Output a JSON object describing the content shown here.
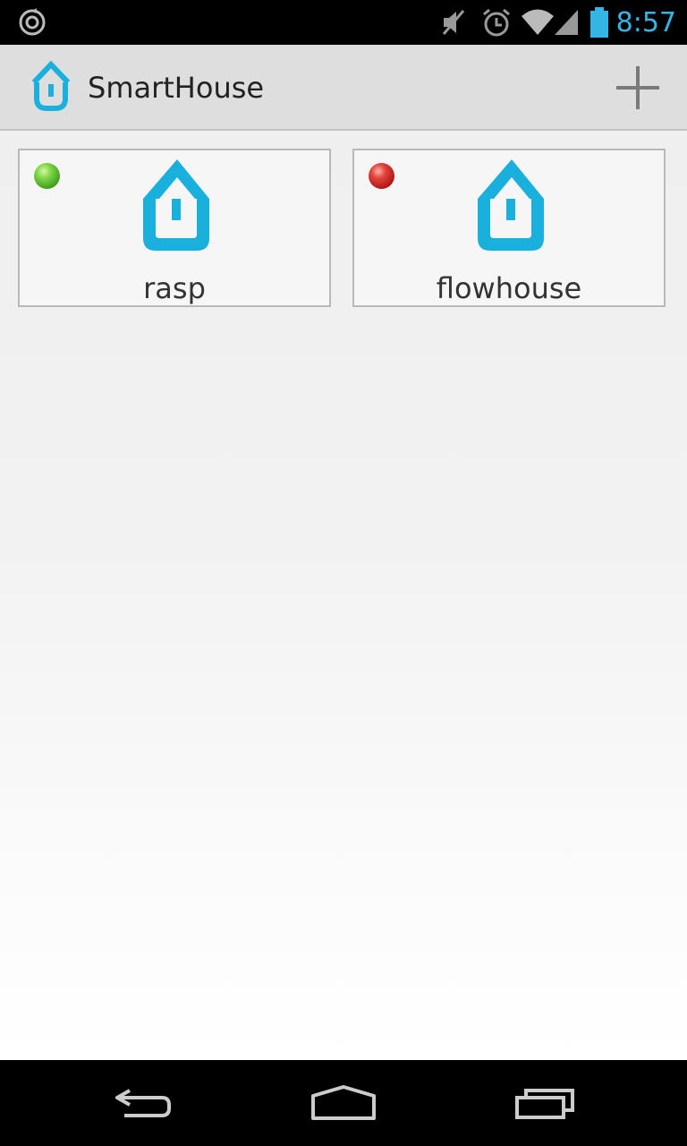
{
  "status_bar": {
    "time": "8:57",
    "icons": [
      "sync-icon",
      "mute-icon",
      "alarm-icon",
      "wifi-icon",
      "signal-icon",
      "battery-icon"
    ]
  },
  "action_bar": {
    "title": "SmartHouse",
    "logo_icon": "smarthouse-logo-icon",
    "add_icon": "plus-icon"
  },
  "houses": [
    {
      "name": "rasp",
      "status": "online",
      "status_color": "#3c9d17",
      "icon": "house-icon"
    },
    {
      "name": "flowhouse",
      "status": "offline",
      "status_color": "#b21414",
      "icon": "house-icon"
    }
  ],
  "colors": {
    "accent": "#1ab0dd",
    "clock": "#33b5e5",
    "action_bar_bg": "#dedede"
  },
  "nav_bar": {
    "icons": [
      "back-icon",
      "home-icon",
      "recent-apps-icon"
    ]
  }
}
